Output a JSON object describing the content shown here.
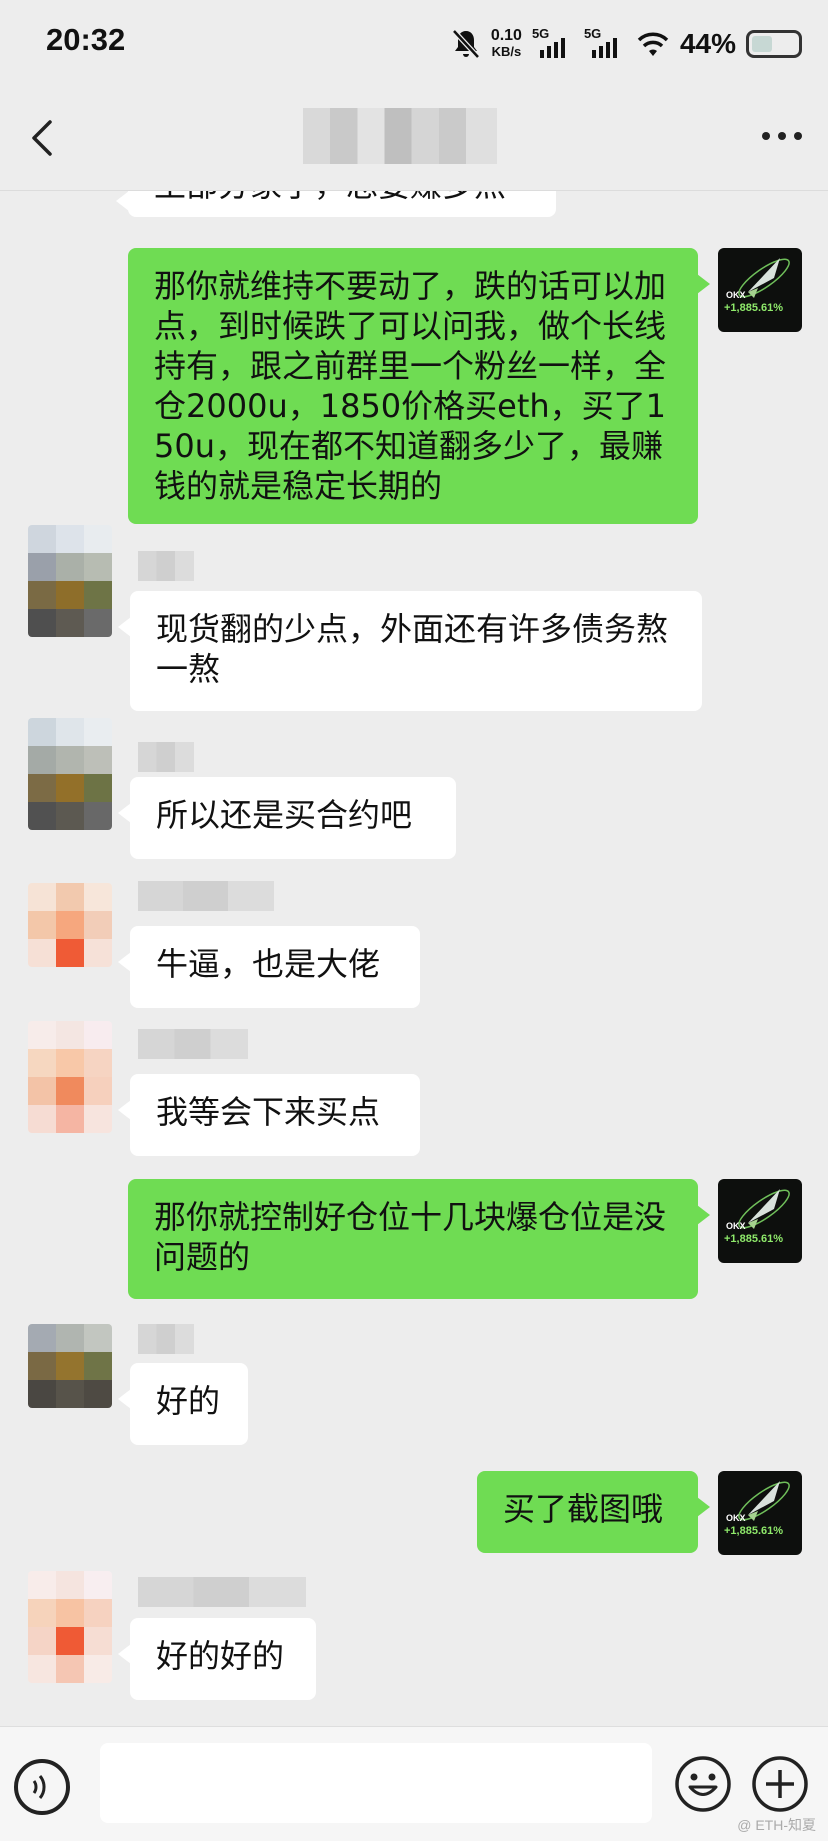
{
  "status_bar": {
    "time": "20:32",
    "net_speed": "0.10",
    "net_speed_unit": "KB/s",
    "sim1": "5G",
    "sim2": "5G",
    "battery": "44%"
  },
  "colors": {
    "bg": "#ededed",
    "my_bubble": "#6fdc53",
    "their_bubble": "#ffffff"
  },
  "avatar": {
    "brand": "OKX",
    "percent": "+1,885.61%"
  },
  "messages": {
    "m0": "王部分家了，总要赚多点",
    "m1": "那你就维持不要动了，跌的话可以加点，到时候跌了可以问我，做个长线持有，跟之前群里一个粉丝一样，全仓2000u，1850价格买eth，买了150u，现在都不知道翻多少了，最赚钱的就是稳定长期的",
    "m2": "现货翻的少点，外面还有许多债务熬一熬",
    "m3": "所以还是买合约吧",
    "m4": "牛逼，也是大佬",
    "m5": "我等会下来买点",
    "m6": "那你就控制好仓位十几块爆仓位是没问题的",
    "m7": "好的",
    "m8": "买了截图哦",
    "m9": "好的好的"
  },
  "watermark": "@ ETH-知夏"
}
